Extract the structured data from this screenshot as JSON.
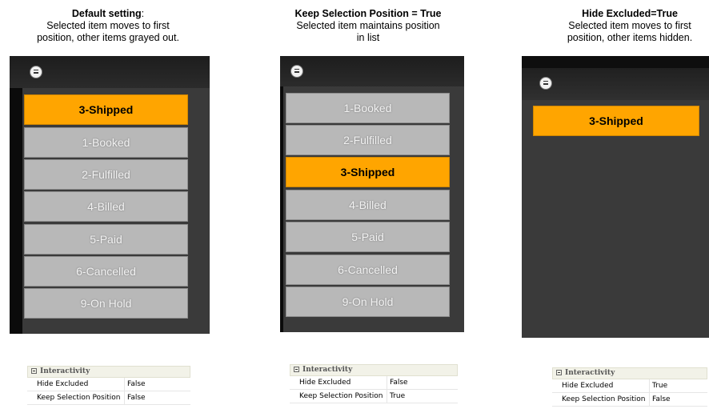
{
  "panels": [
    {
      "caption_title": "Default setting",
      "caption_title_suffix": ":",
      "caption_lines": [
        "Selected item moves to first",
        "position, other items grayed out."
      ],
      "items": [
        "3-Shipped",
        "1-Booked",
        "2-Fulfilled",
        "4-Billed",
        "5-Paid",
        "6-Cancelled",
        "9-On Hold"
      ],
      "selected_index": 0,
      "properties": {
        "header": "Interactivity",
        "rows": [
          {
            "name": "Hide Excluded",
            "value": "False"
          },
          {
            "name": "Keep Selection Position",
            "value": "False"
          }
        ]
      }
    },
    {
      "caption_title": "Keep Selection Position = True",
      "caption_title_suffix": "",
      "caption_lines": [
        "Selected item maintains position",
        "in list"
      ],
      "items": [
        "1-Booked",
        "2-Fulfilled",
        "3-Shipped",
        "4-Billed",
        "5-Paid",
        "6-Cancelled",
        "9-On Hold"
      ],
      "selected_index": 2,
      "properties": {
        "header": "Interactivity",
        "rows": [
          {
            "name": "Hide Excluded",
            "value": "False"
          },
          {
            "name": "Keep Selection Position",
            "value": "True"
          }
        ]
      }
    },
    {
      "caption_title": "Hide Excluded=True",
      "caption_title_suffix": "",
      "caption_lines": [
        "Selected item moves to first",
        "position, other items hidden."
      ],
      "items": [
        "3-Shipped"
      ],
      "selected_index": 0,
      "properties": {
        "header": "Interactivity",
        "rows": [
          {
            "name": "Hide Excluded",
            "value": "True"
          },
          {
            "name": "Keep Selection Position",
            "value": "False"
          }
        ]
      }
    }
  ],
  "colors": {
    "selected": "#ffa500",
    "unselected": "#b8b8b8",
    "panel_background": "#3a3a3a"
  },
  "icons": {
    "menu": "hamburger-circle-icon",
    "collapse": "minus-box-icon"
  }
}
